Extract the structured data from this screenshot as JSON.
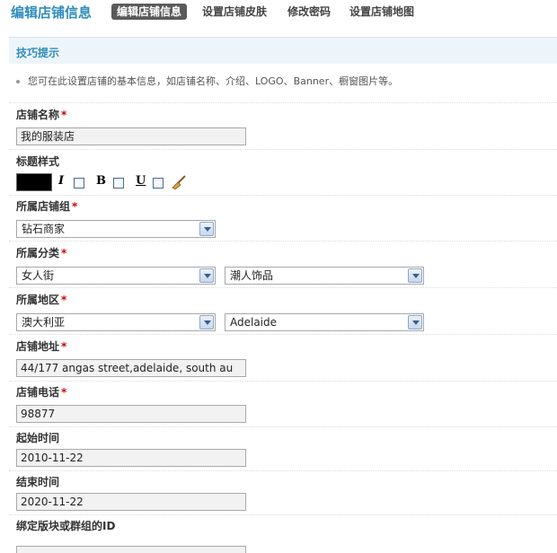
{
  "header": {
    "title": "编辑店铺信息",
    "tabs": [
      {
        "label": "编辑店铺信息",
        "active": true
      },
      {
        "label": "设置店铺皮肤",
        "active": false
      },
      {
        "label": "修改密码",
        "active": false
      },
      {
        "label": "设置店铺地图",
        "active": false
      }
    ]
  },
  "tips": {
    "title": "技巧提示",
    "items": [
      "您可在此设置店铺的基本信息，如店铺名称、介绍、LOGO、Banner、橱窗图片等。"
    ]
  },
  "form": {
    "shop_name": {
      "label": "店铺名称",
      "required": "*",
      "value": "我的服装店"
    },
    "title_style": {
      "label": "标题样式",
      "color": "#000000",
      "italic_label": "I",
      "bold_label": "B",
      "underline_label": "U"
    },
    "shop_group": {
      "label": "所属店铺组",
      "required": "*",
      "selected": "钻石商家"
    },
    "category": {
      "label": "所属分类",
      "required": "*",
      "primary": "女人街",
      "secondary": "潮人饰品"
    },
    "region": {
      "label": "所属地区",
      "required": "*",
      "country": "澳大利亚",
      "city": "Adelaide"
    },
    "address": {
      "label": "店铺地址",
      "required": "*",
      "value": "44/177 angas street,adelaide, south au"
    },
    "phone": {
      "label": "店铺电话",
      "required": "*",
      "value": "98877"
    },
    "start_time": {
      "label": "起始时间",
      "value": "2010-11-22"
    },
    "end_time": {
      "label": "结束时间",
      "value": "2020-11-22"
    },
    "bind_id": {
      "label": "绑定版块或群组的ID",
      "value": ""
    }
  },
  "colors": {
    "accent": "#2f8dbb",
    "required": "#cc0000",
    "tab_active_bg": "#5a5a5a"
  }
}
